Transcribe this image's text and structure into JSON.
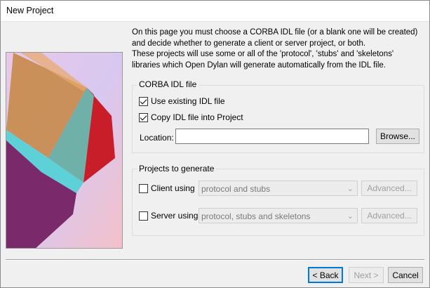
{
  "window": {
    "title": "New Project"
  },
  "intro": {
    "lines": [
      "On this page you must choose a CORBA IDL file (or a blank one will be created)",
      "and decide whether to generate a client or server project, or both.",
      "These projects will use some or all of the 'protocol', 'stubs' and 'skeletons'",
      "libraries which Open Dylan will generate automatically from the IDL file."
    ]
  },
  "idl_group": {
    "legend": "CORBA IDL file",
    "use_existing": {
      "label": "Use existing IDL file",
      "checked": true
    },
    "copy_into_project": {
      "label": "Copy IDL file into Project",
      "checked": true
    },
    "location": {
      "label": "Location:",
      "value": ""
    },
    "browse_label": "Browse..."
  },
  "projects_group": {
    "legend": "Projects to generate",
    "client": {
      "label": "Client using",
      "checked": false,
      "selected": "protocol and stubs",
      "advanced_label": "Advanced..."
    },
    "server": {
      "label": "Server using",
      "checked": false,
      "selected": "protocol, stubs and skeletons",
      "advanced_label": "Advanced..."
    }
  },
  "footer": {
    "back_label": "< Back",
    "next_label": "Next >",
    "cancel_label": "Cancel"
  },
  "colors": {
    "default_button_border": "#0078d7",
    "dialog_bg": "#f0f0f0"
  },
  "icons": {
    "checkbox_mark": "check-icon",
    "dropdown": "chevron-down-icon"
  }
}
